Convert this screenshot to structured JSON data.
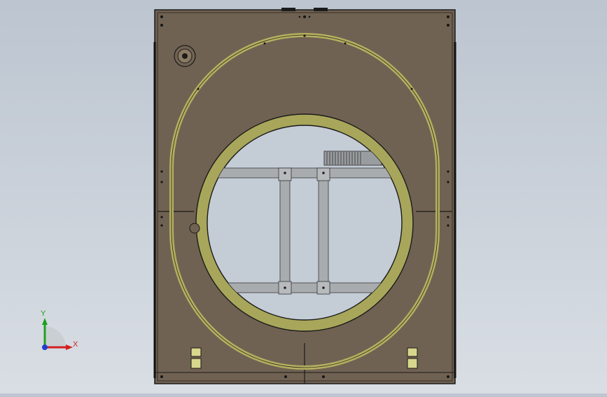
{
  "viewport": {
    "background_top": "#bcc5d0",
    "background_bottom": "#d9dee4"
  },
  "model": {
    "plate_color": "#706252",
    "edge_color": "#1b1b1b",
    "track_color": "#b4b060",
    "ring_color": "#a8a65a",
    "frame_color": "#a8acaf",
    "window_color": "#c4ccd6"
  },
  "triad": {
    "y_label": "Y",
    "x_label": "X",
    "y_color": "#1ea01e",
    "x_color": "#d42020",
    "z_color": "#2040d0"
  }
}
